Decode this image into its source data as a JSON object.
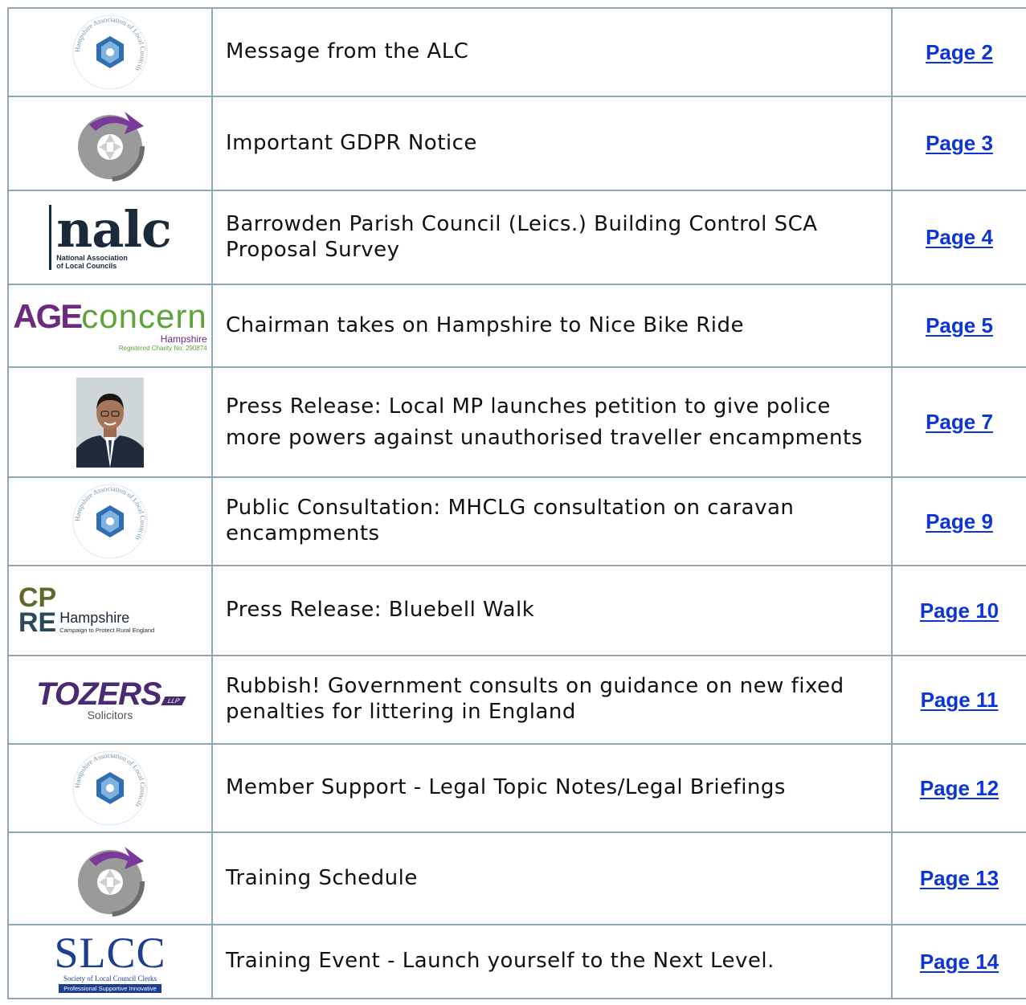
{
  "toc": {
    "rows": [
      {
        "logo": "hampshire-alc-logo",
        "title": "Message from the ALC",
        "page": "Page 2"
      },
      {
        "logo": "arrow-circle-logo",
        "title": "Important GDPR Notice",
        "page": "Page 3"
      },
      {
        "logo": "nalc-logo",
        "title": "Barrowden Parish Council (Leics.) Building Control SCA Proposal Survey",
        "page": "Page 4"
      },
      {
        "logo": "age-concern-logo",
        "title": "Chairman takes on Hampshire to Nice Bike Ride",
        "page": "Page 5"
      },
      {
        "logo": "mp-portrait-photo",
        "title": "Press Release: Local MP launches petition to give police more powers against unauthorised traveller encampments",
        "page": "Page 7"
      },
      {
        "logo": "hampshire-alc-logo",
        "title": "Public Consultation: MHCLG consultation on caravan encampments",
        "page": "Page 9"
      },
      {
        "logo": "cpre-logo",
        "title": "Press Release: Bluebell Walk",
        "page": "Page 10"
      },
      {
        "logo": "tozers-logo",
        "title": "Rubbish! Government consults on guidance on new fixed penalties for littering in England",
        "page": "Page 11"
      },
      {
        "logo": "hampshire-alc-logo",
        "title": "Member Support - Legal Topic Notes/Legal Briefings",
        "page": "Page 12"
      },
      {
        "logo": "arrow-circle-logo",
        "title": "Training Schedule",
        "page": "Page 13"
      },
      {
        "logo": "slcc-logo",
        "title": "Training Event - Launch yourself to the Next Level.",
        "page": "Page 14"
      }
    ]
  },
  "logos": {
    "hampshire_alc_ring": "Hampshire Association of Local Councils",
    "nalc_word": "nalc",
    "nalc_sub1": "National Association",
    "nalc_sub2": "of Local Councils",
    "age_a": "AGE",
    "age_b": "CONCERN",
    "age_sub": "Hampshire",
    "age_charity": "Registered Charity No: 290874",
    "cpre_top": "CP",
    "cpre_bottom": "RE",
    "cpre_name": "Hampshire",
    "cpre_sub": "Campaign to Protect Rural England",
    "tozers_word": "Tozers",
    "tozers_sub": "Solicitors",
    "tozers_llp": "LLP",
    "slcc_word": "SLCC",
    "slcc_sub": "Society of Local Council Clerks",
    "slcc_tag": "Professional Supportive Innovative"
  },
  "colors": {
    "border": "#8fa7b3",
    "link": "#0d35d3",
    "alc_blue": "#2f6fb0",
    "arrow_purple": "#7a3a99",
    "age_purple": "#6b2a7e",
    "age_green": "#5fa33c",
    "tozers_purple": "#4b2a74",
    "slcc_blue": "#1d3e8f"
  }
}
